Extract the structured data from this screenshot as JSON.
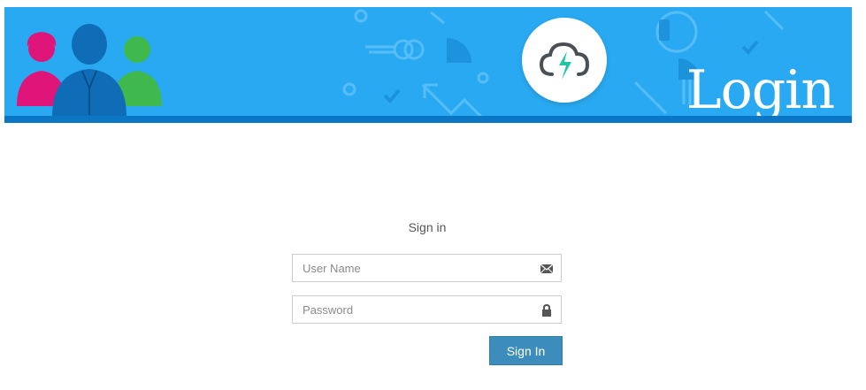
{
  "header": {
    "banner_title": "Login",
    "colors": {
      "banner": "#29a9f2",
      "banner_stripe": "#0a76c4",
      "accent_bolt": "#22c4a8"
    },
    "icons": [
      "people-group-icon",
      "cloud-lightning-icon"
    ]
  },
  "form": {
    "title": "Sign in",
    "username": {
      "value": "",
      "placeholder": "User Name",
      "icon": "envelope-icon"
    },
    "password": {
      "value": "",
      "placeholder": "Password",
      "icon": "lock-icon"
    },
    "submit_label": "Sign In",
    "colors": {
      "button": "#3c8dbc"
    }
  }
}
